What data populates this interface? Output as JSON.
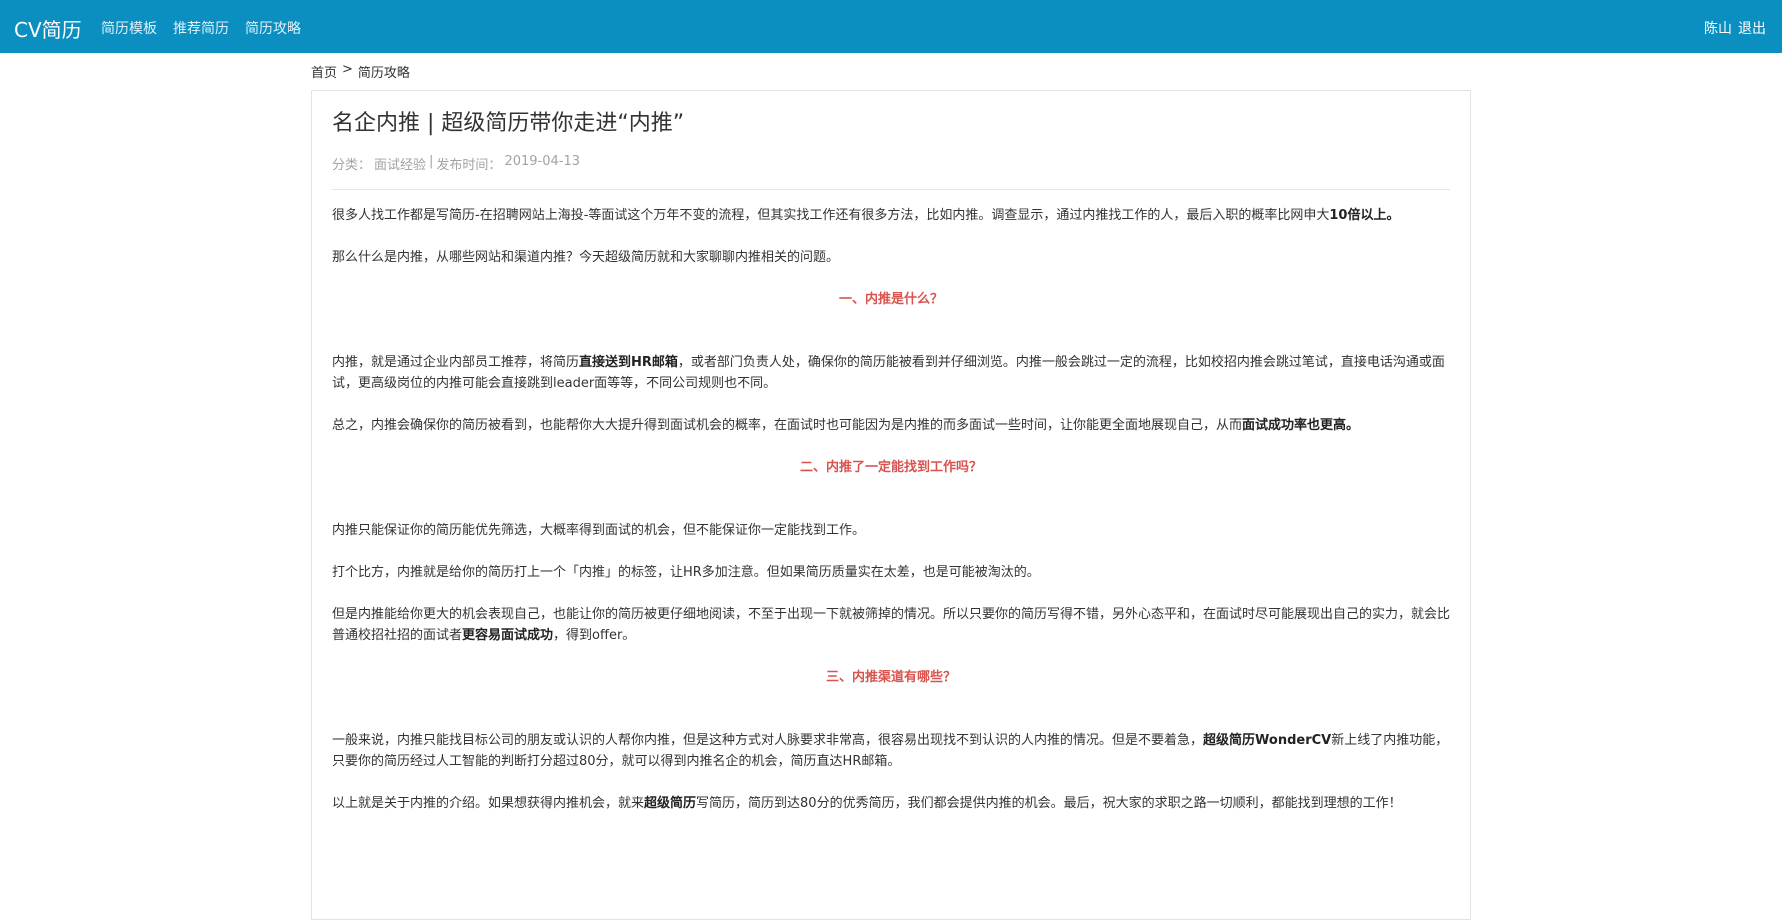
{
  "navbar": {
    "brand": "CV简历",
    "links": [
      "简历模板",
      "推荐简历",
      "简历攻略"
    ],
    "user": "陈山",
    "logout": "退出"
  },
  "breadcrumb": {
    "home": "首页",
    "separator": ">",
    "current": "简历攻略"
  },
  "article": {
    "title": "名企内推 | 超级简历带你走进“内推”",
    "meta": {
      "category_label": "分类：",
      "category": "面试经验",
      "sep": "|",
      "date_label": "发布时间：",
      "date": "2019-04-13"
    },
    "p1": {
      "text": "很多人找工作都是写简历-在招聘网站上海投-等面试这个万年不变的流程，但其实找工作还有很多方法，比如内推。调查显示，通过内推找工作的人，最后入职的概率比网申大",
      "bold": "10倍以上。"
    },
    "p2": "那么什么是内推，从哪些网站和渠道内推？今天超级简历就和大家聊聊内推相关的问题。",
    "h1": "一、内推是什么？",
    "p3": {
      "a": "内推，就是通过企业内部员工推荐，将简历",
      "bold": "直接送到HR邮箱",
      "b": "，或者部门负责人处，确保你的简历能被看到并仔细浏览。内推一般会跳过一定的流程，比如校招内推会跳过笔试，直接电话沟通或面试，更高级岗位的内推可能会直接跳到leader面等等，不同公司规则也不同。"
    },
    "p4": {
      "a": "总之，内推会确保你的简历被看到，也能帮你大大提升得到面试机会的概率，在面试时也可能因为是内推的而多面试一些时间，让你能更全面地展现自己，从而",
      "bold": "面试成功率也更高。"
    },
    "h2": "二、内推了一定能找到工作吗？",
    "p5": "内推只能保证你的简历能优先筛选，大概率得到面试的机会，但不能保证你一定能找到工作。",
    "p6": "打个比方，内推就是给你的简历打上一个「内推」的标签，让HR多加注意。但如果简历质量实在太差，也是可能被淘汰的。",
    "p7": {
      "a": "但是内推能给你更大的机会表现自己，也能让你的简历被更仔细地阅读，不至于出现一下就被筛掉的情况。所以只要你的简历写得不错，另外心态平和，在面试时尽可能展现出自己的实力，就会比普通校招社招的面试者",
      "bold": "更容易面试成功",
      "b": "，得到offer。"
    },
    "h3": "三、内推渠道有哪些？",
    "p8": {
      "a": "一般来说，内推只能找目标公司的朋友或认识的人帮你内推，但是这种方式对人脉要求非常高，很容易出现找不到认识的人内推的情况。但是不要着急，",
      "bold": "超级简历WonderCV",
      "b": "新上线了内推功能，只要你的简历经过人工智能的判断打分超过80分，就可以得到内推名企的机会，简历直达HR邮箱。"
    },
    "p9": {
      "a": "以上就是关于内推的介绍。如果想获得内推机会，就来",
      "bold": "超级简历",
      "b": "写简历，简历到达80分的优秀简历，我们都会提供内推的机会。最后，祝大家的求职之路一切顺利，都能找到理想的工作！"
    }
  }
}
